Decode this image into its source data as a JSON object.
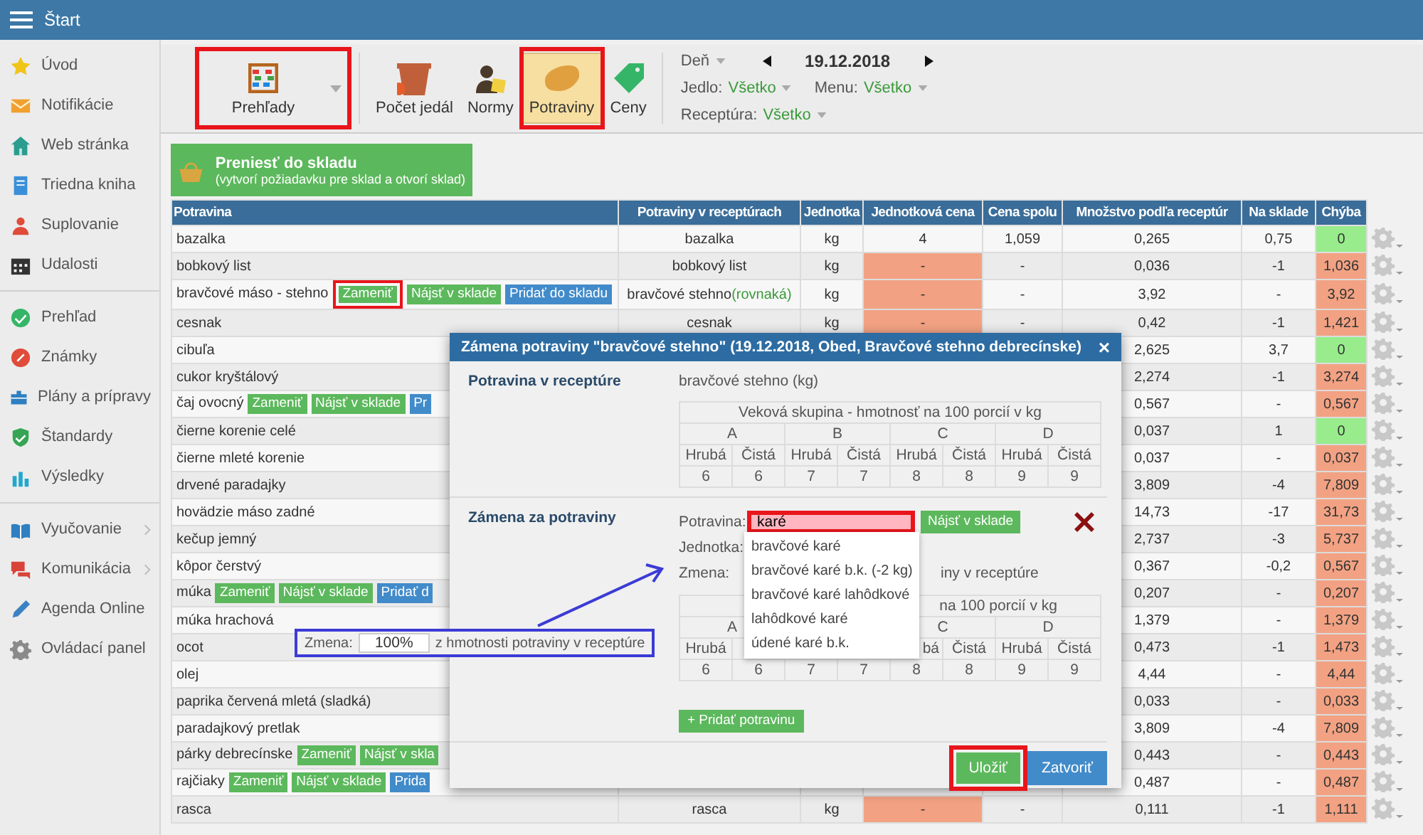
{
  "topbar": {
    "title": "Štart"
  },
  "sidebar": {
    "groups": [
      {
        "items": [
          {
            "label": "Úvod",
            "has_submenu": false
          },
          {
            "label": "Notifikácie",
            "has_submenu": false
          },
          {
            "label": "Web stránka",
            "has_submenu": false
          },
          {
            "label": "Triedna kniha",
            "has_submenu": false
          },
          {
            "label": "Suplovanie",
            "has_submenu": false
          },
          {
            "label": "Udalosti",
            "has_submenu": false
          }
        ]
      },
      {
        "items": [
          {
            "label": "Prehľad",
            "has_submenu": false
          },
          {
            "label": "Známky",
            "has_submenu": false
          },
          {
            "label": "Plány a prípravy",
            "has_submenu": false
          },
          {
            "label": "Štandardy",
            "has_submenu": false
          },
          {
            "label": "Výsledky",
            "has_submenu": false
          }
        ]
      },
      {
        "items": [
          {
            "label": "Vyučovanie",
            "has_submenu": true
          },
          {
            "label": "Komunikácia",
            "has_submenu": true
          },
          {
            "label": "Agenda Online",
            "has_submenu": false
          },
          {
            "label": "Ovládací panel",
            "has_submenu": false
          }
        ]
      }
    ]
  },
  "toolbar": {
    "items": [
      {
        "label": "Prehľady",
        "selected": false,
        "annotated": true,
        "has_menu": true
      },
      {
        "label": "Počet jedál",
        "selected": false,
        "annotated": false,
        "has_menu": false
      },
      {
        "label": "Normy",
        "selected": false,
        "annotated": false,
        "has_menu": false
      },
      {
        "label": "Potraviny",
        "selected": true,
        "annotated": true,
        "has_menu": false
      },
      {
        "label": "Ceny",
        "selected": false,
        "annotated": false,
        "has_menu": false
      }
    ],
    "day_label": "Deň",
    "date": "19.12.2018",
    "filter_lines": [
      {
        "fields": [
          {
            "label": "Jedlo:",
            "value": "Všetko"
          },
          {
            "label": "Menu:",
            "value": "Všetko"
          }
        ]
      },
      {
        "fields": [
          {
            "label": "Receptúra:",
            "value": "Všetko"
          }
        ]
      }
    ]
  },
  "transfer_button": {
    "title": "Preniesť do skladu",
    "subtitle": "(vytvorí požiadavku pre sklad a otvorí sklad)"
  },
  "table": {
    "columns": [
      "Potravina",
      "Potraviny v receptúrach",
      "Jednotka",
      "Jednotková cena",
      "Cena spolu",
      "Množstvo podľa receptúr",
      "Na sklade",
      "Chýba"
    ],
    "rows": [
      {
        "name": "bazalka",
        "buttons": [],
        "recipe": "bazalka",
        "unit": "kg",
        "unit_price": "4",
        "price_missing": false,
        "total": "1,059",
        "qty": "0,265",
        "stock": "0,75",
        "missing": "0",
        "missing_ok": true
      },
      {
        "name": "bobkový list",
        "buttons": [],
        "recipe": "bobkový list",
        "unit": "kg",
        "unit_price": "-",
        "price_missing": true,
        "total": "-",
        "qty": "0,036",
        "stock": "-1",
        "missing": "1,036",
        "missing_ok": false
      },
      {
        "name": "bravčové máso - stehno",
        "buttons": [
          {
            "label": "Zameniť",
            "kind": "replace",
            "annotated": true
          },
          {
            "label": "Nájsť v sklade",
            "kind": "find",
            "annotated": false
          },
          {
            "label": "Pridať do skladu",
            "kind": "add",
            "annotated": false
          }
        ],
        "recipe": "bravčové stehno",
        "recipe_note": "(rovnaká)",
        "unit": "kg",
        "unit_price": "-",
        "price_missing": true,
        "total": "-",
        "qty": "3,92",
        "stock": "-",
        "missing": "3,92",
        "missing_ok": false
      },
      {
        "name": "cesnak",
        "buttons": [],
        "recipe": "cesnak",
        "unit": "kg",
        "unit_price": "-",
        "price_missing": true,
        "total": "-",
        "qty": "0,42",
        "stock": "-1",
        "missing": "1,421",
        "missing_ok": false
      },
      {
        "name": "cibuľa",
        "buttons": [],
        "qty": "2,625",
        "stock": "3,7",
        "missing": "0",
        "missing_ok": true
      },
      {
        "name": "cukor kryštálový",
        "buttons": [],
        "qty": "2,274",
        "stock": "-1",
        "missing": "3,274",
        "missing_ok": false
      },
      {
        "name": "čaj ovocný",
        "buttons": [
          {
            "label": "Zameniť",
            "kind": "replace",
            "annotated": false
          },
          {
            "label": "Nájsť v sklade",
            "kind": "find",
            "annotated": false
          },
          {
            "label": "Pr",
            "kind": "add",
            "annotated": false
          }
        ],
        "qty": "0,567",
        "stock": "-",
        "missing": "0,567",
        "missing_ok": false
      },
      {
        "name": "čierne korenie celé",
        "buttons": [],
        "qty": "0,037",
        "stock": "1",
        "missing": "0",
        "missing_ok": true
      },
      {
        "name": "čierne mleté korenie",
        "buttons": [],
        "qty": "0,037",
        "stock": "-",
        "missing": "0,037",
        "missing_ok": false
      },
      {
        "name": "drvené paradajky",
        "buttons": [],
        "qty": "3,809",
        "stock": "-4",
        "missing": "7,809",
        "missing_ok": false
      },
      {
        "name": "hovädzie máso zadné",
        "buttons": [],
        "qty": "14,73",
        "stock": "-17",
        "missing": "31,73",
        "missing_ok": false
      },
      {
        "name": "kečup jemný",
        "buttons": [],
        "qty": "2,737",
        "stock": "-3",
        "missing": "5,737",
        "missing_ok": false
      },
      {
        "name": "kôpor čerstvý",
        "buttons": [],
        "qty": "0,367",
        "stock": "-0,2",
        "missing": "0,567",
        "missing_ok": false
      },
      {
        "name": "múka",
        "buttons": [
          {
            "label": "Zameniť",
            "kind": "replace",
            "annotated": false
          },
          {
            "label": "Nájsť v sklade",
            "kind": "find",
            "annotated": false
          },
          {
            "label": "Pridať d",
            "kind": "add",
            "annotated": false
          }
        ],
        "qty": "0,207",
        "stock": "-",
        "missing": "0,207",
        "missing_ok": false
      },
      {
        "name": "múka hrachová",
        "buttons": [],
        "qty": "1,379",
        "stock": "-",
        "missing": "1,379",
        "missing_ok": false
      },
      {
        "name": "ocot",
        "buttons": [],
        "qty": "0,473",
        "stock": "-1",
        "missing": "1,473",
        "missing_ok": false
      },
      {
        "name": "olej",
        "buttons": [],
        "qty": "4,44",
        "stock": "-",
        "missing": "4,44",
        "missing_ok": false
      },
      {
        "name": "paprika červená mletá (sladká)",
        "buttons": [],
        "qty": "0,033",
        "stock": "-",
        "missing": "0,033",
        "missing_ok": false
      },
      {
        "name": "paradajkový pretlak",
        "buttons": [],
        "qty": "3,809",
        "stock": "-4",
        "missing": "7,809",
        "missing_ok": false
      },
      {
        "name": "párky debrecínske",
        "buttons": [
          {
            "label": "Zameniť",
            "kind": "replace",
            "annotated": false
          },
          {
            "label": "Nájsť v skla",
            "kind": "find",
            "annotated": false
          }
        ],
        "qty": "0,443",
        "stock": "-",
        "missing": "0,443",
        "missing_ok": false
      },
      {
        "name": "rajčiaky",
        "buttons": [
          {
            "label": "Zameniť",
            "kind": "replace",
            "annotated": false
          },
          {
            "label": "Nájsť v sklade",
            "kind": "find",
            "annotated": false
          },
          {
            "label": "Prida",
            "kind": "add",
            "annotated": false
          }
        ],
        "qty": "0,487",
        "stock": "-",
        "missing": "0,487",
        "missing_ok": false
      },
      {
        "name": "rasca",
        "buttons": [],
        "recipe": "rasca",
        "unit": "kg",
        "unit_price": "-",
        "price_missing": true,
        "total": "-",
        "qty": "0,111",
        "stock": "-1",
        "missing": "1,111",
        "missing_ok": false
      }
    ]
  },
  "dialog": {
    "title": "Zámena potraviny \"bravčové stehno\" (19.12.2018, Obed, Bravčové stehno debrecínske)",
    "close": "×",
    "original": {
      "label": "Potravina v receptúre",
      "value": "bravčové stehno (kg)",
      "table": {
        "caption": "Veková skupina - hmotnosť na 100 porcií v kg",
        "groups": [
          {
            "label": "A",
            "columns": [
              {
                "label": "Hrubá",
                "value": "6"
              },
              {
                "label": "Čistá",
                "value": "6"
              }
            ]
          },
          {
            "label": "B",
            "columns": [
              {
                "label": "Hrubá",
                "value": "7"
              },
              {
                "label": "Čistá",
                "value": "7"
              }
            ]
          },
          {
            "label": "C",
            "columns": [
              {
                "label": "Hrubá",
                "value": "8"
              },
              {
                "label": "Čistá",
                "value": "8"
              }
            ]
          },
          {
            "label": "D",
            "columns": [
              {
                "label": "Hrubá",
                "value": "9"
              },
              {
                "label": "Čistá",
                "value": "9"
              }
            ]
          }
        ]
      }
    },
    "replacement": {
      "label": "Zámena za potraviny",
      "food_label": "Potravina:",
      "food_value": "karé",
      "food_invalid": true,
      "food_annotated": true,
      "find_button": "Nájsť v sklade",
      "unit_label": "Jednotka:",
      "change_label": "Zmena:",
      "change_text": "iny v receptúre",
      "table": {
        "caption": "na 100 porcií v kg",
        "groups": [
          {
            "label": "A",
            "columns": [
              {
                "label": "Hrubá",
                "value": "6"
              },
              {
                "value": "6"
              }
            ]
          },
          {
            "columns": [
              {
                "value": "7"
              },
              {
                "value": "7"
              }
            ]
          },
          {
            "label": "C",
            "columns": [
              {
                "label": "bá",
                "value": "8"
              },
              {
                "label": "Čistá",
                "value": "8"
              }
            ]
          },
          {
            "label": "D",
            "columns": [
              {
                "label": "Hrubá",
                "value": "9"
              },
              {
                "label": "Čistá",
                "value": "9"
              }
            ]
          }
        ]
      },
      "add_button": "+ Pridať potravinu"
    },
    "suggestions": [
      "bravčové karé",
      "bravčové karé b.k. (-2 kg)",
      "bravčové karé lahôdkové",
      "lahôdkové karé",
      "údené karé b.k."
    ],
    "buttons": [
      {
        "label": "Uložiť",
        "kind": "primary",
        "annotated": true
      },
      {
        "label": "Zatvoriť",
        "kind": "secondary",
        "annotated": false
      }
    ]
  },
  "callout": {
    "label": "Zmena:",
    "value": "100%",
    "text": "z hmotnosti potraviny v receptúre"
  }
}
